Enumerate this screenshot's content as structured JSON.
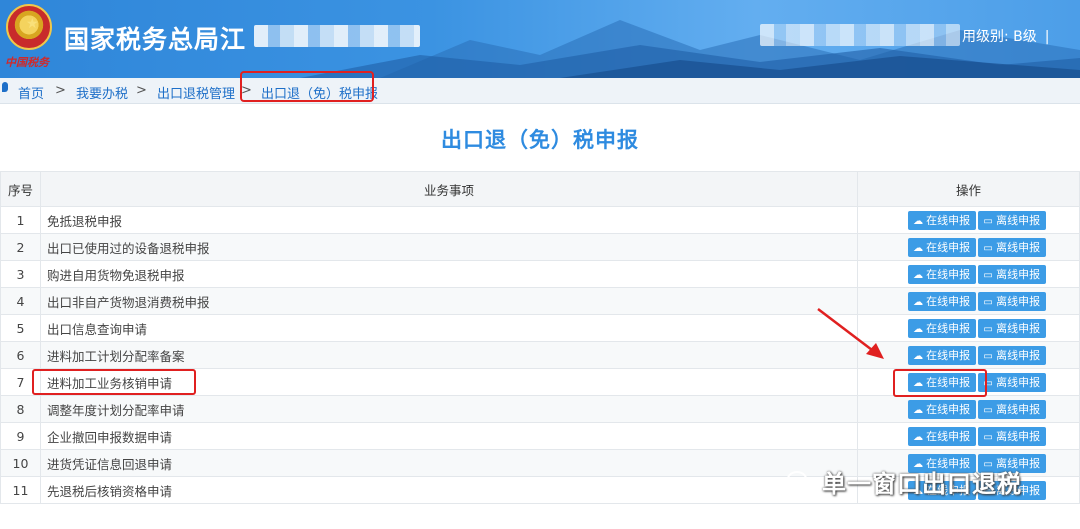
{
  "header": {
    "site_title": "国家税务总局江",
    "user_level": "用级别: B级",
    "separator": "|",
    "emblem_caption": "中国税务"
  },
  "breadcrumb": {
    "items": [
      "首页",
      "我要办税",
      "出口退税管理",
      "出口退（免）税申报"
    ],
    "separator": ">"
  },
  "page": {
    "title": "出口退（免）税申报"
  },
  "table": {
    "headers": {
      "index": "序号",
      "item": "业务事项",
      "ops": "操作"
    },
    "online_label": "在线申报",
    "offline_label": "离线申报",
    "rows": [
      {
        "index": "1",
        "name": "免抵退税申报"
      },
      {
        "index": "2",
        "name": "出口已使用过的设备退税申报"
      },
      {
        "index": "3",
        "name": "购进自用货物免退税申报"
      },
      {
        "index": "4",
        "name": "出口非自产货物退消费税申报"
      },
      {
        "index": "5",
        "name": "出口信息查询申请"
      },
      {
        "index": "6",
        "name": "进料加工计划分配率备案"
      },
      {
        "index": "7",
        "name": "进料加工业务核销申请"
      },
      {
        "index": "8",
        "name": "调整年度计划分配率申请"
      },
      {
        "index": "9",
        "name": "企业撤回申报数据申请"
      },
      {
        "index": "10",
        "name": "进货凭证信息回退申请"
      },
      {
        "index": "11",
        "name": "先退税后核销资格申请"
      }
    ]
  },
  "watermark": {
    "text": "单一窗口出口退税"
  },
  "colors": {
    "accent": "#2e8be0",
    "button": "#3c9ce6",
    "annotation": "#e02020"
  }
}
